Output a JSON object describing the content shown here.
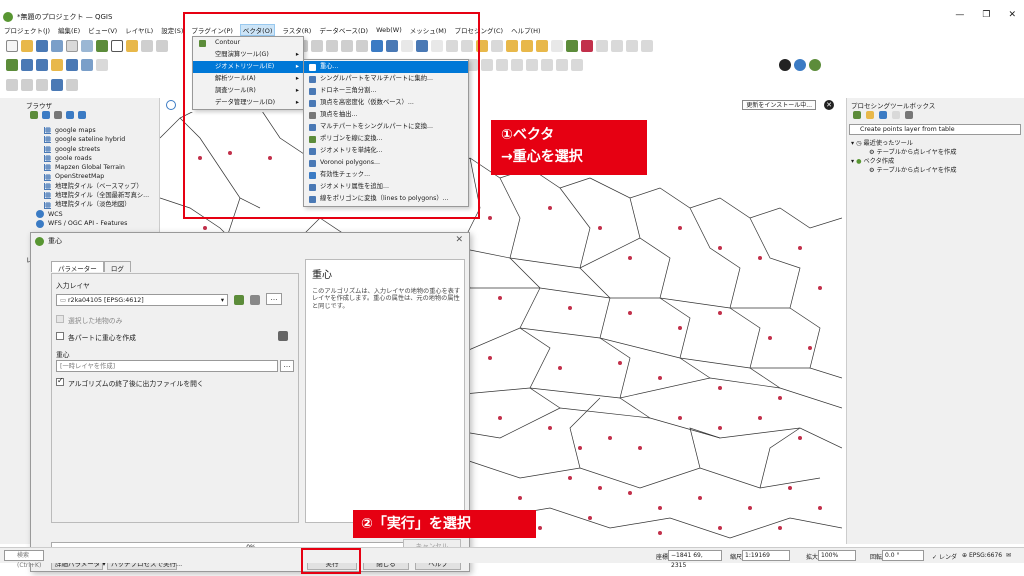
{
  "window": {
    "title": "*無題のプロジェクト — QGIS",
    "min": "—",
    "max": "❐",
    "close": "✕"
  },
  "menubar": [
    "プロジェクト(J)",
    "編集(E)",
    "ビュー(V)",
    "レイヤ(L)",
    "設定(S)",
    "プラグイン(P)",
    "ベクタ(O)",
    "ラスタ(R)",
    "データベース(D)",
    "Web(W)",
    "メッシュ(M)",
    "プロセシング(C)",
    "ヘルプ(H)"
  ],
  "vector_menu": {
    "items": [
      {
        "label": "Contour",
        "arrow": ""
      },
      {
        "label": "空間演算ツール(G)",
        "arrow": "▸"
      },
      {
        "label": "ジオメトリツール(E)",
        "arrow": "▸"
      },
      {
        "label": "解析ツール(A)",
        "arrow": "▸"
      },
      {
        "label": "調査ツール(R)",
        "arrow": "▸"
      },
      {
        "label": "データ管理ツール(D)",
        "arrow": "▸"
      }
    ]
  },
  "geometry_submenu": {
    "items": [
      "重心...",
      "シングルパートをマルチパートに集約...",
      "ドロネー三角分割...",
      "頂点を高密度化（仮数ベース）...",
      "頂点を抽出...",
      "マルチパートをシングルパートに変換...",
      "ポリゴンを線に変換...",
      "ジオメトリを単純化...",
      "Voronoi polygons...",
      "有効性チェック...",
      "ジオメトリ属性を追加...",
      "線をポリゴンに変換（lines to polygons）..."
    ]
  },
  "browser": {
    "title": "ブラウザ",
    "items": [
      "google maps",
      "google sateline hybrid",
      "google streets",
      "goole roads",
      "Mapzen Global Terrain",
      "OpenStreetMap",
      "地理院タイル（ベースマップ）",
      "地理院タイル（全国最新写真シ...",
      "地理院タイル（淡色地図）"
    ],
    "services": [
      "WCS",
      "WFS / OGC API - Features"
    ],
    "layers_title": "レイヤ"
  },
  "message_bar": {
    "install_button": "更新をインストール中..."
  },
  "toolbox": {
    "title": "プロセシングツールボックス",
    "search": "Create points layer from table",
    "rows": [
      "最近使ったツール",
      "テーブルから点レイヤを作成",
      "ベクタ作成",
      "テーブルから点レイヤを作成"
    ]
  },
  "dialog": {
    "title": "重心",
    "tabs": [
      "パラメーター",
      "ログ"
    ],
    "input_layer_label": "入力レイヤ",
    "input_layer_value": "r2ka04105 [EPSG:4612]",
    "selected_only": "選択した地物のみ",
    "each_part": "各パートに重心を作成",
    "output_label": "重心",
    "output_placeholder": "[一時レイヤを作成]",
    "open_output": "アルゴリズムの終了後に出力ファイルを開く",
    "help_title": "重心",
    "help_text": "このアルゴリズムは、入力レイヤの地物の重心を表すレイヤを作成します。重心の属性は、元の地物の属性と同じです。",
    "progress": "0%",
    "cancel": "キャンセル",
    "advanced": "詳細パラメータ ▾",
    "batch": "バッチプロセスで実行...",
    "run": "実行",
    "close": "閉じる",
    "help": "ヘルプ"
  },
  "annotations": {
    "step1_line1": "①ベクタ",
    "step1_line2": "→重心を選択",
    "step2": "②「実行」を選択"
  },
  "statusbar": {
    "search_placeholder": "検索 (Ctrl+K)",
    "coord_label": "座標",
    "coord_value": "−1841 69, 2315",
    "scale_label": "縮尺",
    "scale_value": "1:19169",
    "magnify_label": "拡大",
    "magnify_value": "100%",
    "rotation_label": "回転",
    "rotation_value": "0.0 °",
    "render_label": "レンダ",
    "crs": "EPSG:6676"
  },
  "colors": {
    "highlight": "#0078d7",
    "annotation_red": "#e60012",
    "point": "#c2304b",
    "qgis_green": "#589632"
  }
}
